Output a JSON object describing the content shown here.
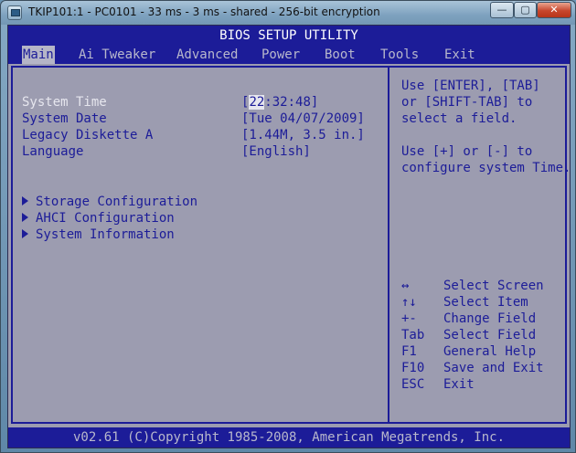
{
  "window": {
    "title": "TKIP101:1 - PC0101 - 33 ms - 3 ms - shared - 256-bit encryption",
    "min_glyph": "—",
    "max_glyph": "▢",
    "close_glyph": "✕",
    "icon": "remote-console-icon"
  },
  "bios": {
    "title": "BIOS SETUP UTILITY",
    "menu": [
      {
        "label": "Main",
        "active": true
      },
      {
        "label": "Ai Tweaker"
      },
      {
        "label": "Advanced"
      },
      {
        "label": "Power"
      },
      {
        "label": "Boot"
      },
      {
        "label": "Tools"
      },
      {
        "label": "Exit"
      }
    ],
    "settings": [
      {
        "label": "System Time",
        "value_prefix": "[",
        "value_cursor": "22",
        "value_rest": ":32:48]",
        "selected": true
      },
      {
        "label": "System Date",
        "value": "[Tue 04/07/2009]"
      },
      {
        "label": "Legacy Diskette A",
        "value": "[1.44M, 3.5 in.]"
      },
      {
        "label": "Language",
        "value": "[English]"
      }
    ],
    "submenus": [
      {
        "label": "Storage Configuration"
      },
      {
        "label": "AHCI Configuration"
      },
      {
        "label": "System Information"
      }
    ],
    "help_text": [
      "Use [ENTER], [TAB]",
      "or [SHIFT-TAB] to",
      "select a field.",
      "",
      "Use [+] or [-] to",
      "configure system Time."
    ],
    "keys": [
      {
        "key": "↔",
        "desc": "Select Screen"
      },
      {
        "key": "↑↓",
        "desc": "Select Item"
      },
      {
        "key": "+-",
        "desc": "Change Field"
      },
      {
        "key": "Tab",
        "desc": "Select Field"
      },
      {
        "key": "F1",
        "desc": "General Help"
      },
      {
        "key": "F10",
        "desc": "Save and Exit"
      },
      {
        "key": "ESC",
        "desc": "Exit"
      }
    ],
    "footer": "v02.61 (C)Copyright 1985-2008, American Megatrends, Inc."
  }
}
